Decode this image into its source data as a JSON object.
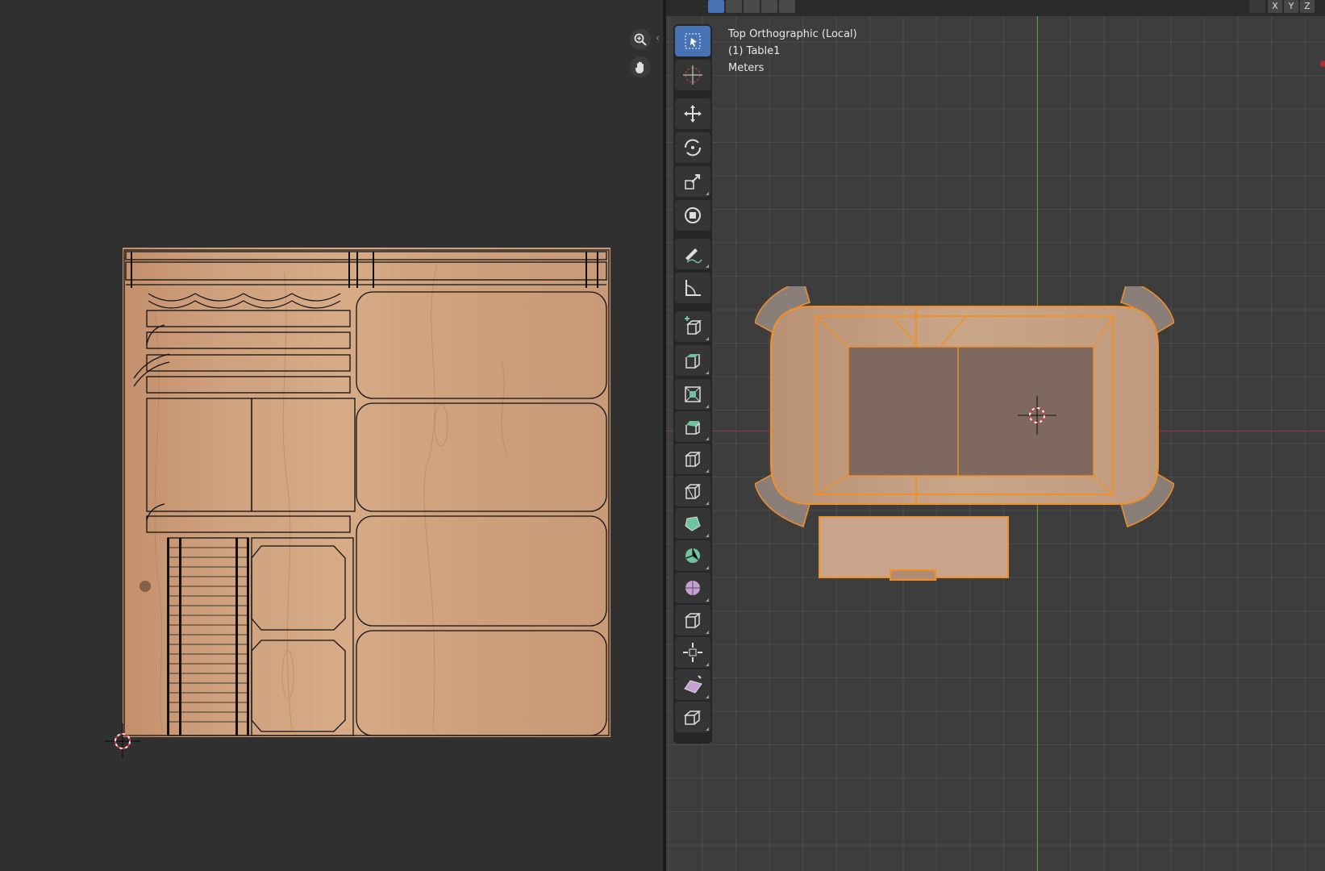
{
  "viewport": {
    "view_label": "Top Orthographic (Local)",
    "object_label": "(1) Table1",
    "units_label": "Meters"
  },
  "header": {
    "axis_buttons": [
      "X",
      "Y",
      "Z"
    ]
  },
  "toolbar": {
    "tools": [
      "select-box-icon",
      "cursor-icon",
      "move-icon",
      "rotate-icon",
      "scale-icon",
      "transform-icon",
      "annotate-icon",
      "measure-icon",
      "add-cube-icon",
      "extrude-region-icon",
      "inset-faces-icon",
      "bevel-icon",
      "loop-cut-icon",
      "knife-icon",
      "poly-build-icon",
      "spin-icon",
      "smooth-icon",
      "edge-slide-icon",
      "shrink-fatten-icon",
      "shear-icon",
      "rip-region-icon"
    ],
    "active_tool": "select-box-icon"
  },
  "colors": {
    "selection_orange": "#f0902a",
    "active_tool_blue": "#4772b3",
    "wood_light": "#c9a07a",
    "x_axis_red": "#8a3a3a",
    "y_axis_green": "#6a9a2a"
  }
}
